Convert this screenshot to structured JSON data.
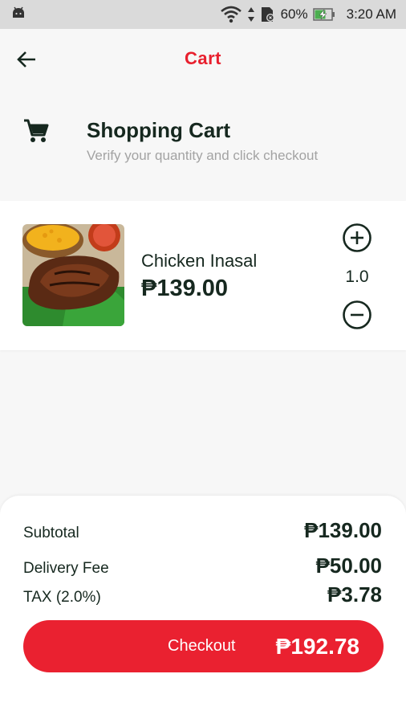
{
  "status_bar": {
    "battery_percent": "60%",
    "time": "3:20 AM",
    "icons": [
      "android-icon",
      "wifi-icon",
      "data-arrows-icon",
      "sim-icon",
      "battery-charging-icon"
    ]
  },
  "app_bar": {
    "title": "Cart",
    "back_icon": "arrow-left-icon"
  },
  "cart_header": {
    "icon": "shopping-cart-icon",
    "title": "Shopping Cart",
    "subtitle": "Verify your quantity and click checkout"
  },
  "items": [
    {
      "name": "Chicken Inasal",
      "price": "₱139.00",
      "quantity": "1.0",
      "image": "chicken-inasal-photo"
    }
  ],
  "summary": {
    "subtotal_label": "Subtotal",
    "subtotal_value": "₱139.00",
    "delivery_label": "Delivery Fee",
    "delivery_value": "₱50.00",
    "tax_label": "TAX (2.0%)",
    "tax_value": "₱3.78"
  },
  "checkout": {
    "label": "Checkout",
    "total": "₱192.78"
  },
  "colors": {
    "accent": "#e8202e",
    "text_dark": "#16281f",
    "subtitle": "#a3a3a3",
    "status_bar_bg": "#dadada",
    "page_bg": "#f7f7f7"
  }
}
